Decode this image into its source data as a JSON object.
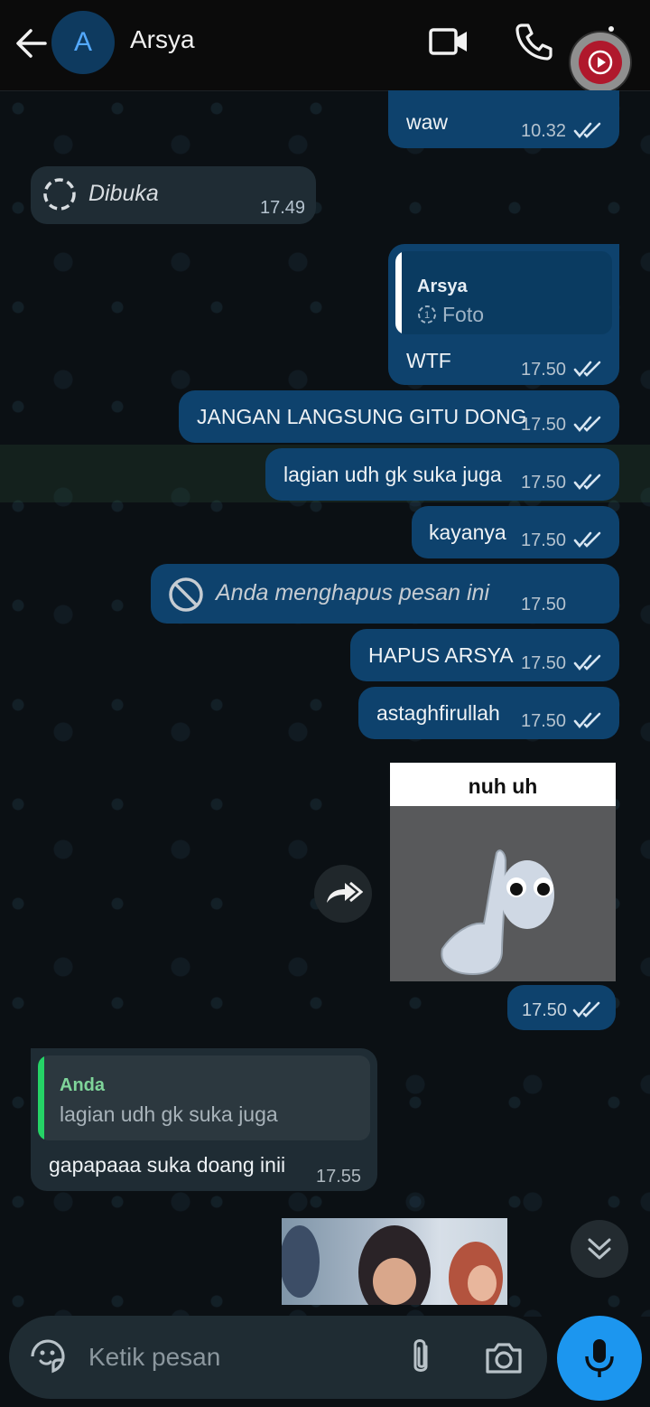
{
  "header": {
    "avatar_initial": "A",
    "contact_name": "Arsya"
  },
  "messages": {
    "m1": {
      "text": "waw",
      "time": "10.32"
    },
    "m2": {
      "text": "Dibuka",
      "time": "17.49"
    },
    "m3": {
      "quote_author": "Arsya",
      "quote_text": "Foto",
      "text": "WTF",
      "time": "17.50"
    },
    "m4": {
      "text": "JANGAN LANGSUNG GITU DONG",
      "time": "17.50"
    },
    "m5": {
      "text": "lagian udh gk suka juga",
      "time": "17.50"
    },
    "m6": {
      "text": "kayanya",
      "time": "17.50"
    },
    "m7": {
      "text": "Anda menghapus pesan ini",
      "time": "17.50"
    },
    "m8": {
      "text": "HAPUS ARSYA",
      "time": "17.50"
    },
    "m9": {
      "text": "astaghfirullah",
      "time": "17.50"
    },
    "m10": {
      "sticker_caption": "nuh uh",
      "time": "17.50"
    },
    "m11": {
      "quote_author": "Anda",
      "quote_text": "lagian udh gk suka juga",
      "text": "gapapaaa suka doang inii",
      "time": "17.55"
    }
  },
  "composer": {
    "placeholder": "Ketik pesan"
  },
  "colors": {
    "outgoing_bubble": "#0e426d",
    "incoming_bubble": "#1f2c34",
    "accent_blue": "#1c96ef",
    "quote_outgoing_bar": "#ffffff",
    "quote_incoming_bar": "#25d366",
    "quote_incoming_author": "#7fd59a"
  },
  "icons": [
    "back-arrow-icon",
    "video-call-icon",
    "phone-icon",
    "more-vert-icon",
    "screen-record-icon",
    "view-once-icon",
    "double-check-icon",
    "deleted-icon",
    "forward-icon",
    "double-chevron-down-icon",
    "sticker-icon",
    "paperclip-icon",
    "camera-icon",
    "mic-icon"
  ]
}
